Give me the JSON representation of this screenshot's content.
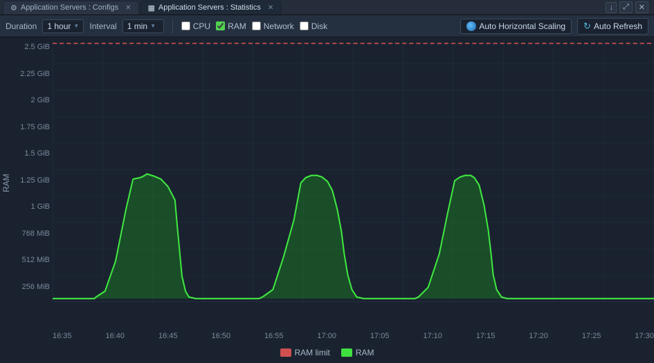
{
  "tabs": [
    {
      "id": "configs",
      "label": "Application Servers : Configs",
      "icon": "⚙",
      "active": false,
      "closable": true
    },
    {
      "id": "statistics",
      "label": "Application Servers : Statistics",
      "icon": "📊",
      "active": true,
      "closable": true
    }
  ],
  "tabbar_actions": [
    "↓",
    "⤢",
    "✕"
  ],
  "toolbar": {
    "duration_label": "Duration",
    "duration_value": "1 hour",
    "interval_label": "Interval",
    "interval_value": "1 min",
    "checkboxes": [
      {
        "id": "cpu",
        "label": "CPU",
        "checked": false
      },
      {
        "id": "ram",
        "label": "RAM",
        "checked": true
      },
      {
        "id": "network",
        "label": "Network",
        "checked": false
      },
      {
        "id": "disk",
        "label": "Disk",
        "checked": false
      }
    ],
    "auto_horiz_label": "Auto Horizontal Scaling",
    "auto_refresh_label": "Auto Refresh"
  },
  "chart": {
    "y_axis_label": "RAM",
    "y_ticks": [
      "2.5 GiB",
      "2.25 GiB",
      "2 GiB",
      "1.75 GiB",
      "1.5 GiB",
      "1.25 GiB",
      "1 GiB",
      "768 MiB",
      "512 MiB",
      "256 MiB",
      ""
    ],
    "x_ticks": [
      "16:35",
      "16:40",
      "16:45",
      "16:50",
      "16:55",
      "17:00",
      "17:05",
      "17:10",
      "17:15",
      "17:20",
      "17:25",
      "17:30"
    ],
    "ram_limit_color": "#e05050",
    "ram_color": "#40e040",
    "ram_fill_color": "rgba(40, 180, 40, 0.35)"
  },
  "legend": [
    {
      "id": "ram-limit",
      "label": "RAM limit",
      "color": "#d05050"
    },
    {
      "id": "ram",
      "label": "RAM",
      "color": "#40e040"
    }
  ]
}
